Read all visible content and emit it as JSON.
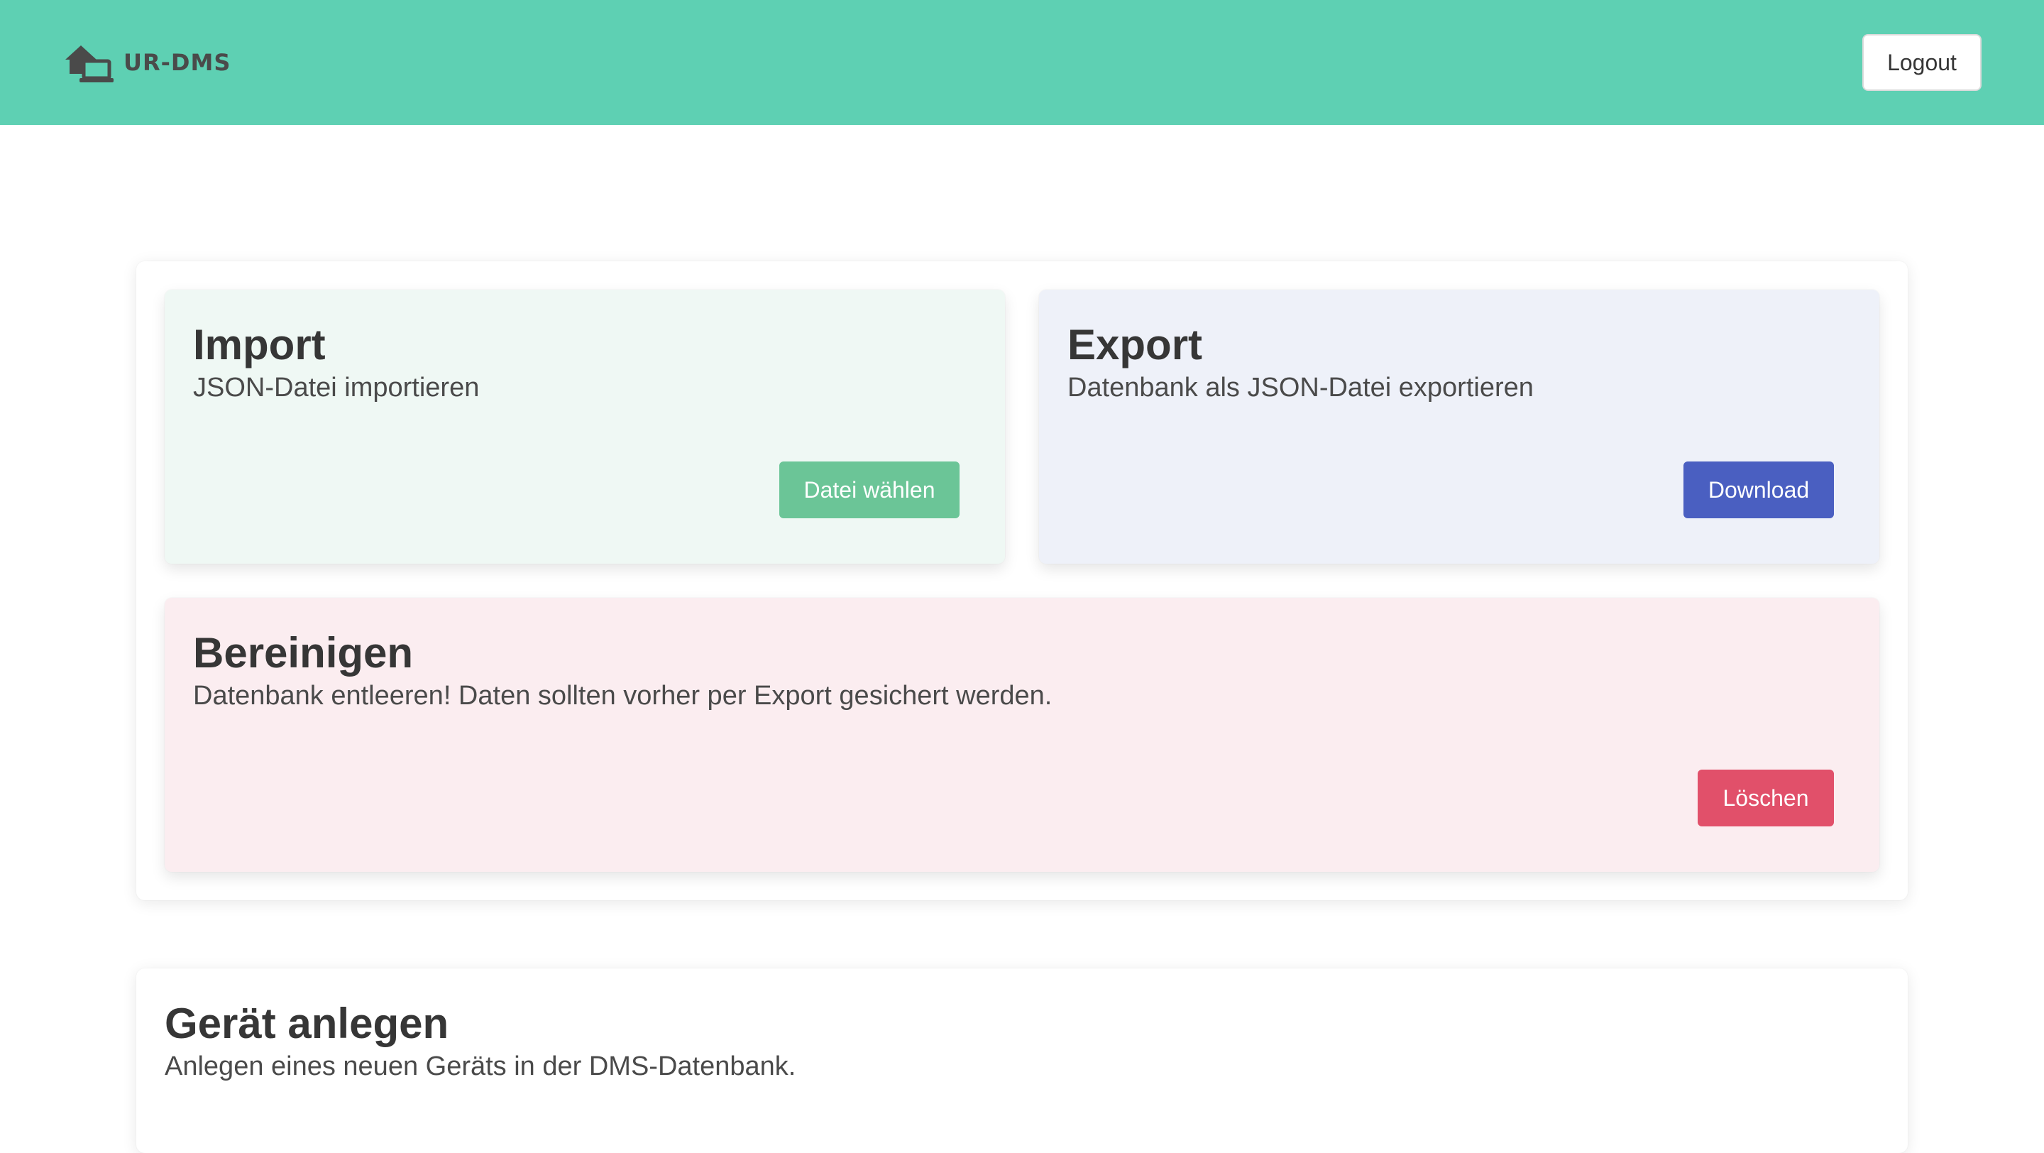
{
  "navbar": {
    "brand_name": "UR-DMS",
    "brand_icon": "house-devices-icon",
    "logout_label": "Logout",
    "background": "#5ed0b3"
  },
  "import": {
    "title": "Import",
    "subtitle": "JSON-Datei importieren",
    "button_label": "Datei wählen",
    "button_color": "#6bc597"
  },
  "export": {
    "title": "Export",
    "subtitle": "Datenbank als JSON-Datei exportieren",
    "button_label": "Download",
    "button_color": "#4a5fc1"
  },
  "clean": {
    "title": "Bereinigen",
    "subtitle": "Datenbank entleeren! Daten sollten vorher per Export gesichert werden.",
    "button_label": "Löschen",
    "button_color": "#e1506a"
  },
  "device": {
    "title": "Gerät anlegen",
    "subtitle": "Anlegen eines neuen Geräts in der DMS-Datenbank."
  }
}
